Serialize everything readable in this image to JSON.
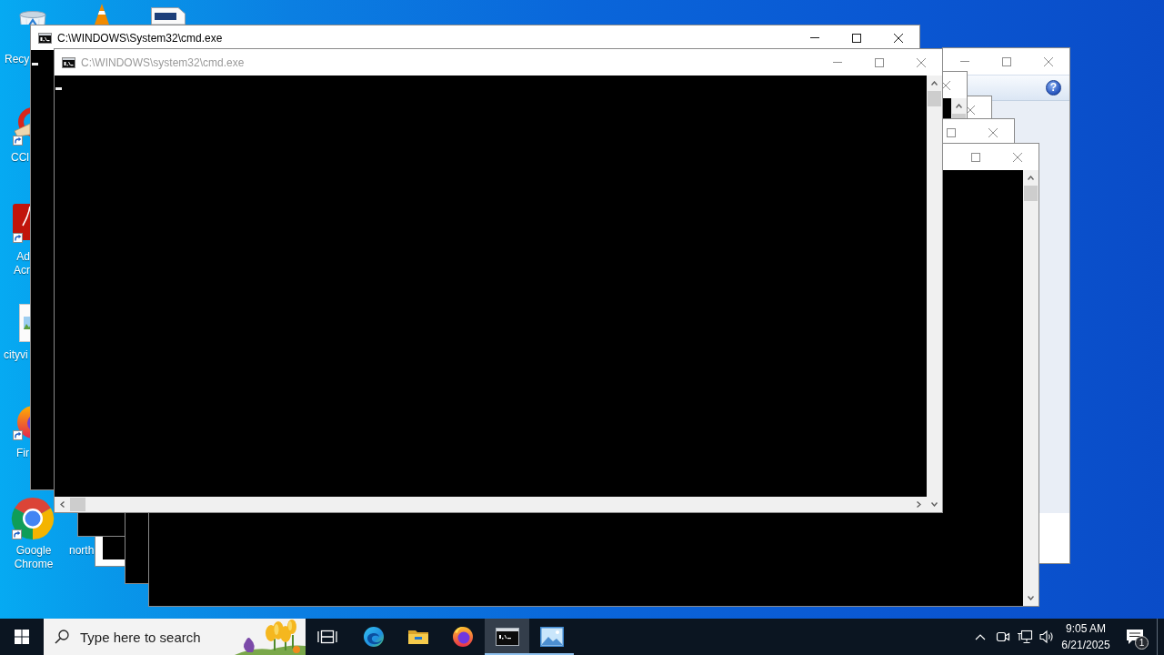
{
  "desktop": {
    "icons": [
      {
        "label": "Recy"
      },
      {
        "label": "CCl"
      },
      {
        "label": "Ad Acr"
      },
      {
        "label": "cityvi"
      },
      {
        "label": "Fir"
      },
      {
        "label": "Google Chrome"
      },
      {
        "label": "north"
      }
    ]
  },
  "windows": [
    {
      "kind": "console",
      "active": true,
      "title": "C:\\WINDOWS\\System32\\cmd.exe"
    },
    {
      "kind": "console",
      "active": false,
      "title": "C:\\WINDOWS\\system32\\cmd.exe"
    },
    {
      "kind": "dialog",
      "active": false,
      "help": "?"
    },
    {
      "kind": "console",
      "active": false
    },
    {
      "kind": "console",
      "active": false
    },
    {
      "kind": "console",
      "active": false
    },
    {
      "kind": "console",
      "active": false
    }
  ],
  "taskbar": {
    "search": {
      "placeholder": "Type here to search"
    },
    "apps": [
      {
        "running": false,
        "selected": false
      },
      {
        "running": false,
        "selected": false
      },
      {
        "running": false,
        "selected": false
      },
      {
        "running": true,
        "selected": true
      },
      {
        "running": true,
        "selected": false
      }
    ],
    "clock": {
      "time": "9:05 AM",
      "date": "6/21/2025"
    },
    "notifications": {
      "count": "1"
    }
  }
}
